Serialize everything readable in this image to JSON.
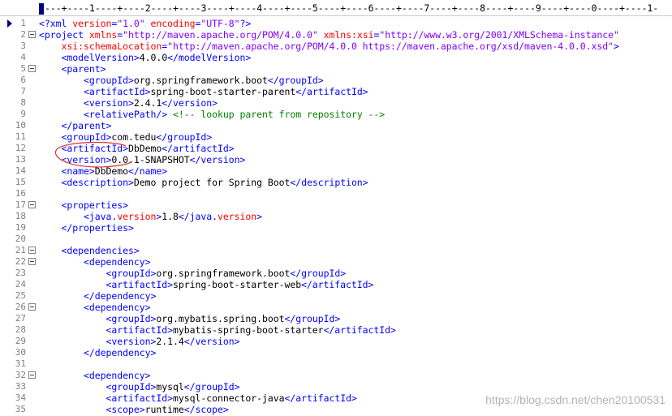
{
  "ruler": {
    "text": "---+----1----+----2----+----3----+----4----+----5----+----6----+----7----+----8----+----9----+----0----+----1-"
  },
  "watermark": "https://blog.csdn.net/chen20100531",
  "lines": [
    {
      "n": "1",
      "fold": false,
      "segs": [
        [
          "t",
          "<?xml "
        ],
        [
          "a",
          "version"
        ],
        [
          "t",
          "="
        ],
        [
          "v",
          "\"1.0\""
        ],
        [
          "t",
          " "
        ],
        [
          "a",
          "encoding"
        ],
        [
          "t",
          "="
        ],
        [
          "v",
          "\"UTF-8\""
        ],
        [
          "t",
          "?>"
        ]
      ]
    },
    {
      "n": "2",
      "fold": true,
      "segs": [
        [
          "t",
          "<project "
        ],
        [
          "a",
          "xmlns"
        ],
        [
          "t",
          "="
        ],
        [
          "v",
          "\"http://maven.apache.org/POM/4.0.0\""
        ],
        [
          "t",
          " "
        ],
        [
          "a",
          "xmlns:xsi"
        ],
        [
          "t",
          "="
        ],
        [
          "v",
          "\"http://www.w3.org/2001/XMLSchema-instance\""
        ]
      ]
    },
    {
      "n": "3",
      "fold": false,
      "segs": [
        [
          "x",
          "    "
        ],
        [
          "a",
          "xsi:schemaLocation"
        ],
        [
          "t",
          "="
        ],
        [
          "v",
          "\"http://maven.apache.org/POM/4.0.0 https://maven.apache.org/xsd/maven-4.0.0.xsd\""
        ],
        [
          "t",
          ">"
        ]
      ]
    },
    {
      "n": "4",
      "fold": false,
      "segs": [
        [
          "x",
          "    "
        ],
        [
          "t",
          "<modelVersion>"
        ],
        [
          "x",
          "4.0.0"
        ],
        [
          "t",
          "</modelVersion>"
        ]
      ]
    },
    {
      "n": "5",
      "fold": true,
      "segs": [
        [
          "x",
          "    "
        ],
        [
          "t",
          "<parent>"
        ]
      ]
    },
    {
      "n": "6",
      "fold": false,
      "segs": [
        [
          "x",
          "        "
        ],
        [
          "t",
          "<groupId>"
        ],
        [
          "x",
          "org.springframework.boot"
        ],
        [
          "t",
          "</groupId>"
        ]
      ]
    },
    {
      "n": "7",
      "fold": false,
      "segs": [
        [
          "x",
          "        "
        ],
        [
          "t",
          "<artifactId>"
        ],
        [
          "x",
          "spring-boot-starter-parent"
        ],
        [
          "t",
          "</artifactId>"
        ]
      ]
    },
    {
      "n": "8",
      "fold": false,
      "segs": [
        [
          "x",
          "        "
        ],
        [
          "t",
          "<version>"
        ],
        [
          "x",
          "2.4.1"
        ],
        [
          "t",
          "</version>"
        ]
      ]
    },
    {
      "n": "9",
      "fold": false,
      "segs": [
        [
          "x",
          "        "
        ],
        [
          "t",
          "<relativePath/>"
        ],
        [
          "x",
          " "
        ],
        [
          "c",
          "<!-- lookup parent from repository -->"
        ]
      ]
    },
    {
      "n": "10",
      "fold": false,
      "segs": [
        [
          "x",
          "    "
        ],
        [
          "t",
          "</parent>"
        ]
      ]
    },
    {
      "n": "11",
      "fold": false,
      "segs": [
        [
          "x",
          "    "
        ],
        [
          "t",
          "<groupId>"
        ],
        [
          "x",
          "com.tedu"
        ],
        [
          "t",
          "</groupId>"
        ]
      ]
    },
    {
      "n": "12",
      "fold": false,
      "segs": [
        [
          "x",
          "    "
        ],
        [
          "t",
          "<artifactId>"
        ],
        [
          "x",
          "DbDemo"
        ],
        [
          "t",
          "</artifactId>"
        ]
      ]
    },
    {
      "n": "13",
      "fold": false,
      "segs": [
        [
          "x",
          "    "
        ],
        [
          "t",
          "<version>"
        ],
        [
          "x",
          "0.0.1-SNAPSHOT"
        ],
        [
          "t",
          "</version>"
        ]
      ]
    },
    {
      "n": "14",
      "fold": false,
      "segs": [
        [
          "x",
          "    "
        ],
        [
          "t",
          "<name>"
        ],
        [
          "x",
          "DbDemo"
        ],
        [
          "t",
          "</name>"
        ]
      ]
    },
    {
      "n": "15",
      "fold": false,
      "segs": [
        [
          "x",
          "    "
        ],
        [
          "t",
          "<description>"
        ],
        [
          "x",
          "Demo project for Spring Boot"
        ],
        [
          "t",
          "</description>"
        ]
      ]
    },
    {
      "n": "16",
      "fold": false,
      "segs": []
    },
    {
      "n": "17",
      "fold": true,
      "segs": [
        [
          "x",
          "    "
        ],
        [
          "t",
          "<properties>"
        ]
      ]
    },
    {
      "n": "18",
      "fold": false,
      "segs": [
        [
          "x",
          "        "
        ],
        [
          "t",
          "<java."
        ],
        [
          "a",
          "version"
        ],
        [
          "t",
          ">"
        ],
        [
          "x",
          "1.8"
        ],
        [
          "t",
          "</java."
        ],
        [
          "a",
          "version"
        ],
        [
          "t",
          ">"
        ]
      ]
    },
    {
      "n": "19",
      "fold": false,
      "segs": [
        [
          "x",
          "    "
        ],
        [
          "t",
          "</properties>"
        ]
      ]
    },
    {
      "n": "20",
      "fold": false,
      "segs": []
    },
    {
      "n": "21",
      "fold": true,
      "segs": [
        [
          "x",
          "    "
        ],
        [
          "t",
          "<dependencies>"
        ]
      ]
    },
    {
      "n": "22",
      "fold": true,
      "segs": [
        [
          "x",
          "        "
        ],
        [
          "t",
          "<dependency>"
        ]
      ]
    },
    {
      "n": "23",
      "fold": false,
      "segs": [
        [
          "x",
          "            "
        ],
        [
          "t",
          "<groupId>"
        ],
        [
          "x",
          "org.springframework.boot"
        ],
        [
          "t",
          "</groupId>"
        ]
      ]
    },
    {
      "n": "24",
      "fold": false,
      "segs": [
        [
          "x",
          "            "
        ],
        [
          "t",
          "<artifactId>"
        ],
        [
          "x",
          "spring-boot-starter-web"
        ],
        [
          "t",
          "</artifactId>"
        ]
      ]
    },
    {
      "n": "25",
      "fold": false,
      "segs": [
        [
          "x",
          "        "
        ],
        [
          "t",
          "</dependency>"
        ]
      ]
    },
    {
      "n": "26",
      "fold": true,
      "segs": [
        [
          "x",
          "        "
        ],
        [
          "t",
          "<dependency>"
        ]
      ]
    },
    {
      "n": "27",
      "fold": false,
      "segs": [
        [
          "x",
          "            "
        ],
        [
          "t",
          "<groupId>"
        ],
        [
          "x",
          "org.mybatis.spring.boot"
        ],
        [
          "t",
          "</groupId>"
        ]
      ]
    },
    {
      "n": "28",
      "fold": false,
      "segs": [
        [
          "x",
          "            "
        ],
        [
          "t",
          "<artifactId>"
        ],
        [
          "x",
          "mybatis-spring-boot-starter"
        ],
        [
          "t",
          "</artifactId>"
        ]
      ]
    },
    {
      "n": "29",
      "fold": false,
      "segs": [
        [
          "x",
          "            "
        ],
        [
          "t",
          "<version>"
        ],
        [
          "x",
          "2.1.4"
        ],
        [
          "t",
          "</version>"
        ]
      ]
    },
    {
      "n": "30",
      "fold": false,
      "segs": [
        [
          "x",
          "        "
        ],
        [
          "t",
          "</dependency>"
        ]
      ]
    },
    {
      "n": "31",
      "fold": false,
      "segs": []
    },
    {
      "n": "32",
      "fold": true,
      "segs": [
        [
          "x",
          "        "
        ],
        [
          "t",
          "<dependency>"
        ]
      ]
    },
    {
      "n": "33",
      "fold": false,
      "segs": [
        [
          "x",
          "            "
        ],
        [
          "t",
          "<groupId>"
        ],
        [
          "x",
          "mysql"
        ],
        [
          "t",
          "</groupId>"
        ]
      ]
    },
    {
      "n": "34",
      "fold": false,
      "segs": [
        [
          "x",
          "            "
        ],
        [
          "t",
          "<artifactId>"
        ],
        [
          "x",
          "mysql-connector-java"
        ],
        [
          "t",
          "</artifactId>"
        ]
      ]
    },
    {
      "n": "35",
      "fold": false,
      "segs": [
        [
          "x",
          "            "
        ],
        [
          "t",
          "<scope>"
        ],
        [
          "x",
          "runtime"
        ],
        [
          "t",
          "</scope>"
        ]
      ]
    }
  ]
}
